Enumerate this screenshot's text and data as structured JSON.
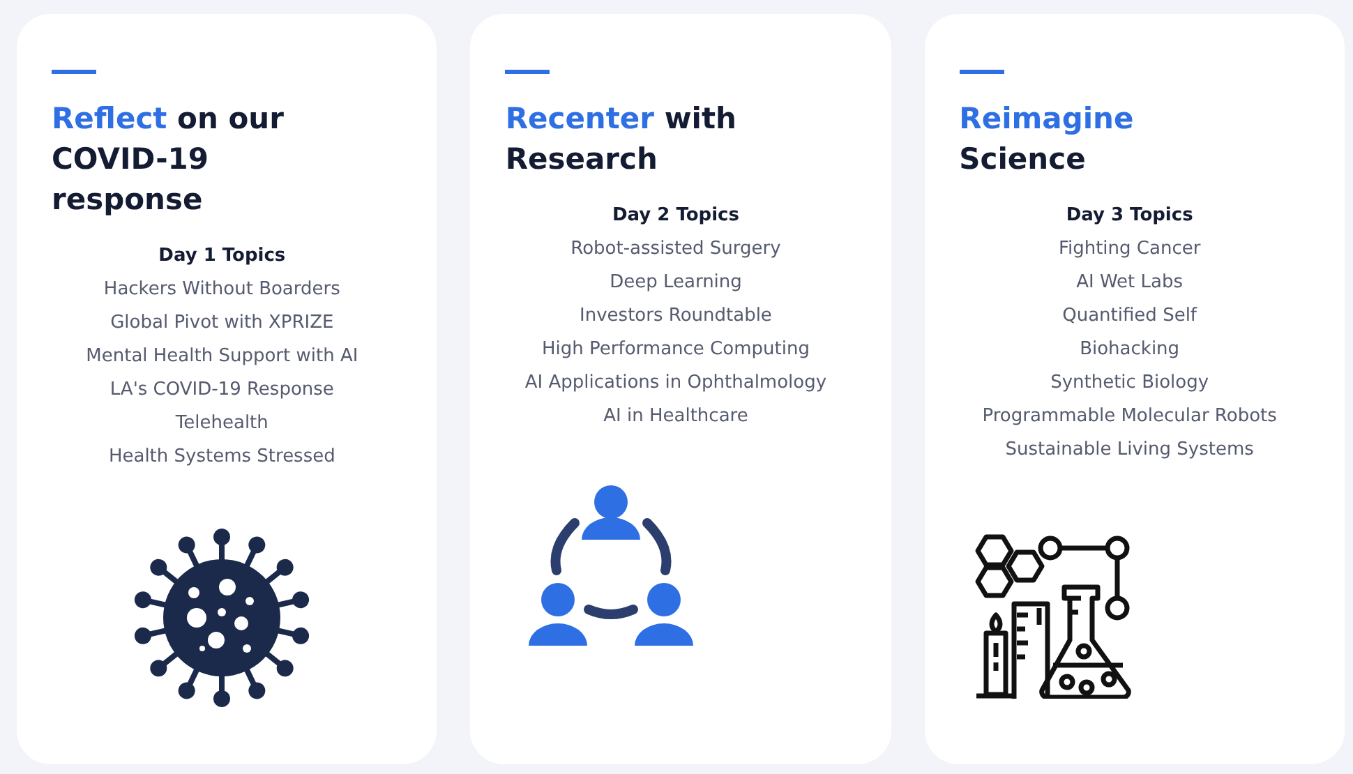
{
  "cards": [
    {
      "title": {
        "accent": "Reflect",
        "rest": "on our COVID-19 response"
      },
      "topics_heading": "Day 1 Topics",
      "topics": [
        "Hackers Without Boarders",
        "Global Pivot with XPRIZE",
        "Mental Health Support with AI",
        "LA's COVID-19 Response",
        "Telehealth",
        "Health Systems Stressed"
      ],
      "icon": {
        "kind": "virus"
      }
    },
    {
      "title": {
        "accent": "Recenter",
        "rest": "with Research"
      },
      "topics_heading": "Day 2 Topics",
      "topics": [
        "Robot-assisted Surgery",
        "Deep Learning",
        "Investors Roundtable",
        "High Performance Computing",
        "AI Applications in Ophthalmology",
        "AI in Healthcare"
      ],
      "icon": {
        "kind": "people"
      }
    },
    {
      "title": {
        "accent": "Reimagine",
        "rest": "Science"
      },
      "topics_heading": "Day 3 Topics",
      "topics": [
        "Fighting Cancer",
        "AI Wet Labs",
        "Quantified Self",
        "Biohacking",
        "Synthetic Biology",
        "Programmable Molecular Robots",
        "Sustainable Living Systems"
      ],
      "icon": {
        "kind": "lab"
      }
    }
  ]
}
